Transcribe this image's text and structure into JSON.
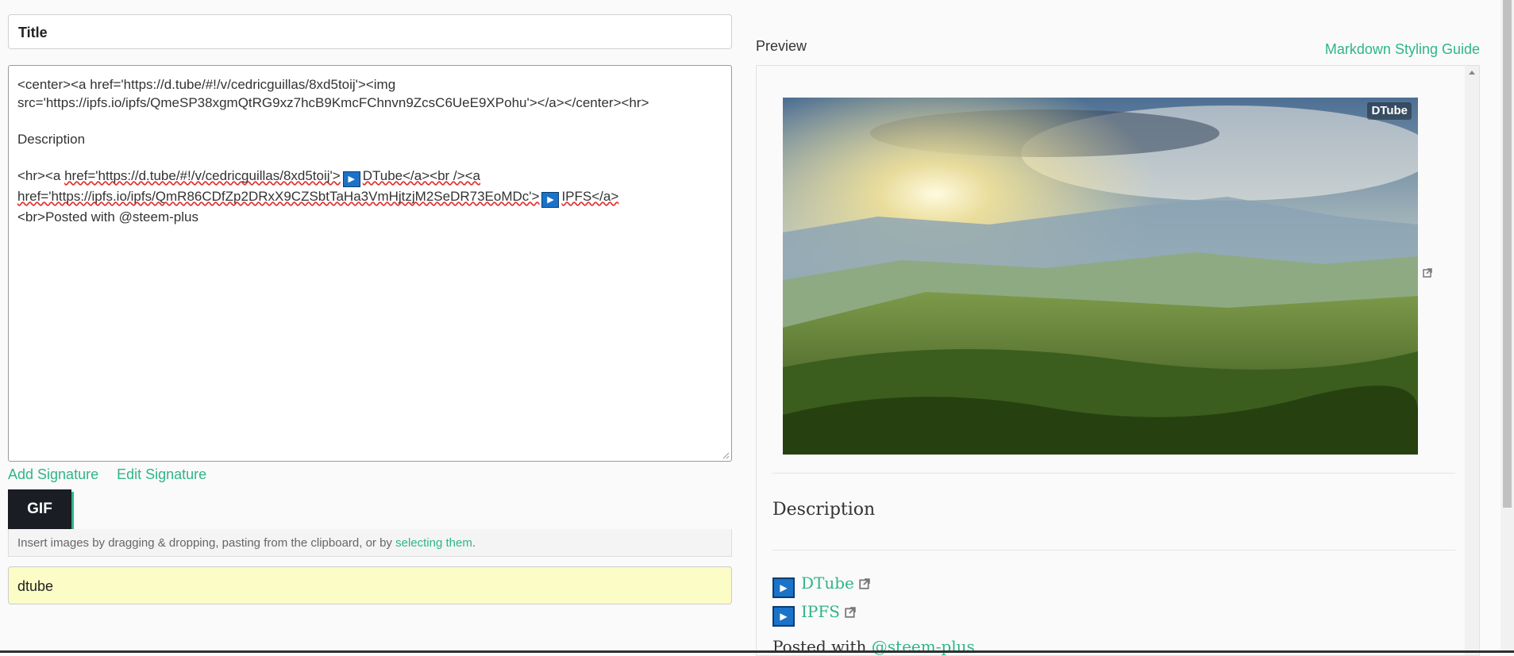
{
  "editor": {
    "title_placeholder": "Title",
    "body_lines": [
      "<center><a href='https://d.tube/#!/v/cedricguillas/8xd5toij'><img",
      "src='https://ipfs.io/ipfs/QmeSP38xgmQtRG9xz7hcB9KmcFChnvn9ZcsC6UeE9XPohu'></a></center><hr>",
      "",
      "Description",
      ""
    ],
    "line6": {
      "a": "<hr><a ",
      "b": "href='https://d.tube/#!/v/cedricguillas/8xd5toij'>",
      "c": "DTube</a><br /><a"
    },
    "line7": {
      "a": "href='https://ipfs.io/ipfs/QmR86CDfZp2DRxX9CZSbtTaHa3VmHjtzjM2SeDR73EoMDc'>",
      "b": "IPFS</a>"
    },
    "line8": "<br>Posted with @steem-plus",
    "add_signature": "Add Signature",
    "edit_signature": "Edit Signature",
    "gif_label": "GIF",
    "drop_hint": "Insert images by dragging & dropping, pasting from the clipboard, or by ",
    "drop_hint_link": "selecting them",
    "drop_hint_end": ".",
    "tags_value": "dtube"
  },
  "preview": {
    "label": "Preview",
    "styling_guide": "Markdown Styling Guide",
    "thumb_logo": "DTube",
    "description_heading": "Description",
    "link_dtube": "DTube",
    "link_ipfs": "IPFS",
    "posted_with": "Posted with ",
    "posted_user": "@steem-plus"
  },
  "colors": {
    "accent": "#2fb58a",
    "tags_bg": "#fbfcc6",
    "gif_bg": "#1a1d24",
    "play_icon": "#1a73c8"
  }
}
